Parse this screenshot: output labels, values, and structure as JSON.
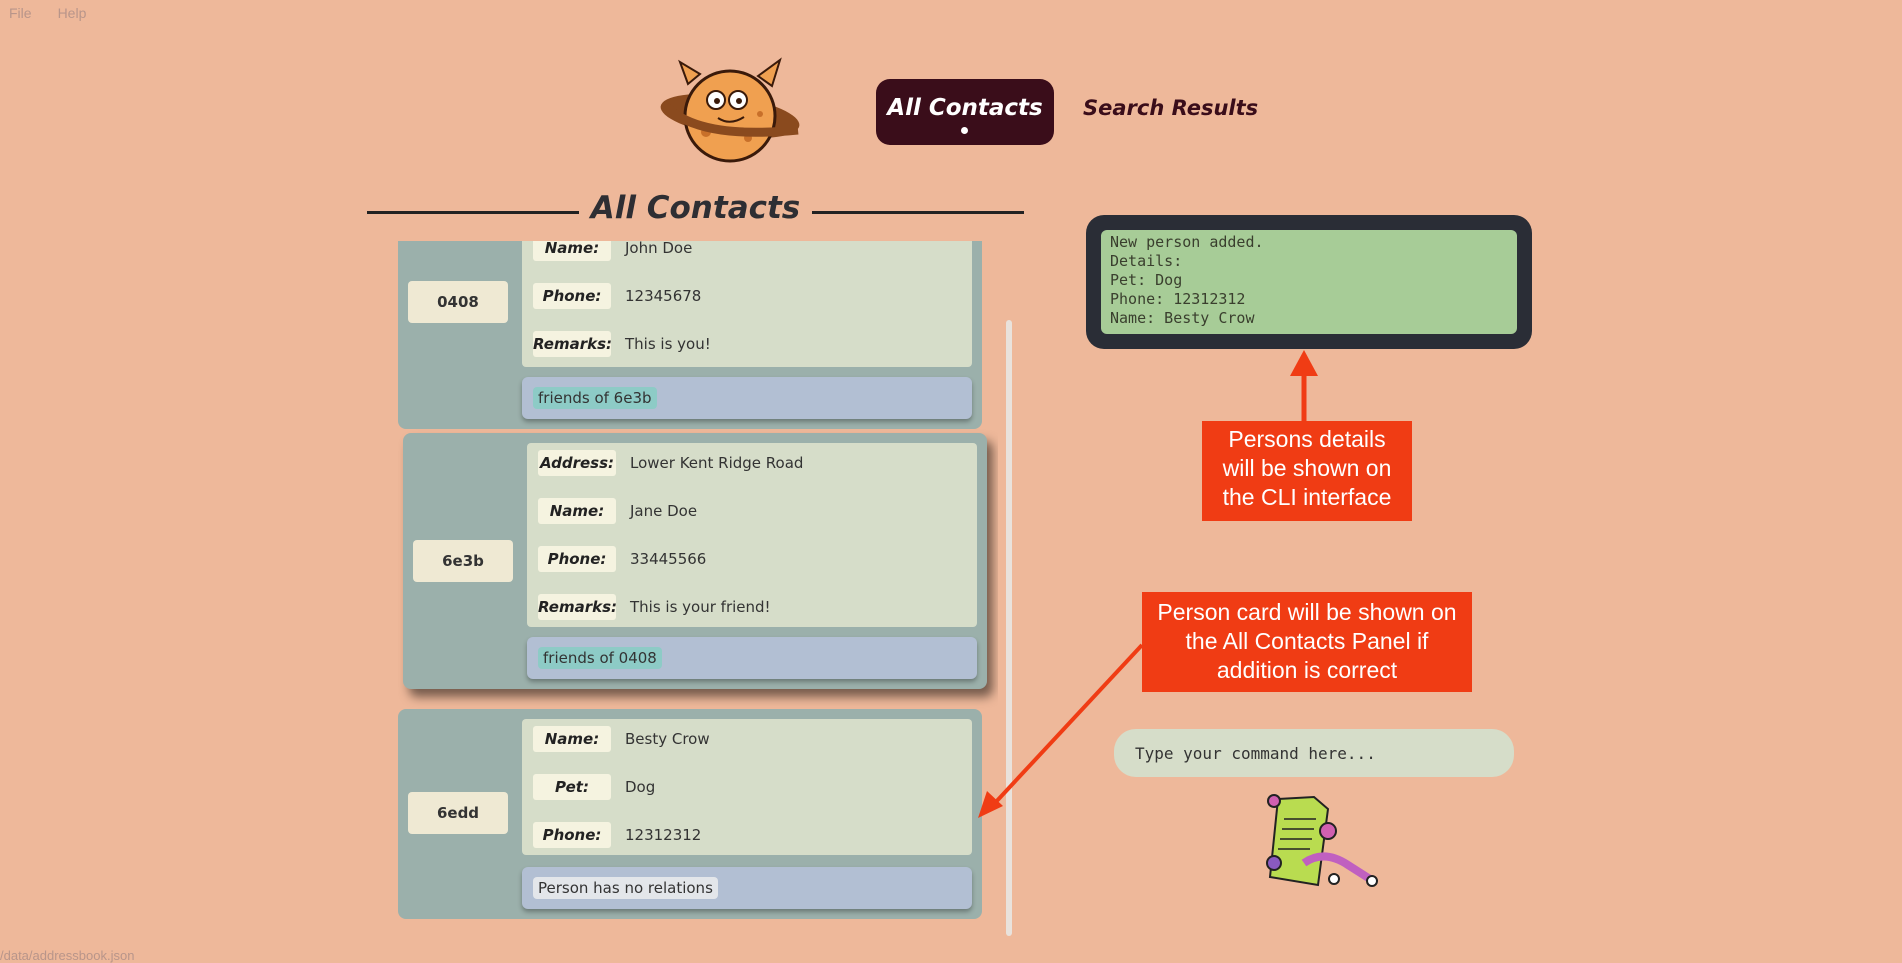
{
  "menu": {
    "file": "File",
    "help": "Help"
  },
  "tabs": {
    "active": "All Contacts",
    "inactive": "Search Results"
  },
  "panel": {
    "title": "All Contacts"
  },
  "contacts": [
    {
      "id": "0408",
      "fields": [
        {
          "label": "Name:",
          "value": "John Doe"
        },
        {
          "label": "Phone:",
          "value": "12345678"
        },
        {
          "label": "Remarks:",
          "value": "This is you!"
        }
      ],
      "tag": "friends of 6e3b"
    },
    {
      "id": "6e3b",
      "fields": [
        {
          "label": "Address:",
          "value": "Lower Kent Ridge Road"
        },
        {
          "label": "Name:",
          "value": "Jane Doe"
        },
        {
          "label": "Phone:",
          "value": "33445566"
        },
        {
          "label": "Remarks:",
          "value": "This is your friend!"
        }
      ],
      "tag": "friends of 0408"
    },
    {
      "id": "6edd",
      "fields": [
        {
          "label": "Name:",
          "value": "Besty Crow"
        },
        {
          "label": "Pet:",
          "value": "Dog"
        },
        {
          "label": "Phone:",
          "value": "12312312"
        }
      ],
      "tag": "Person has no relations"
    }
  ],
  "cli": {
    "lines": [
      "New person added.",
      "Details:",
      "Pet: Dog",
      "Phone: 12312312",
      "Name: Besty Crow"
    ]
  },
  "annotations": {
    "cli_note": [
      "Persons details",
      "will be shown on",
      "the CLI interface"
    ],
    "card_note": [
      "Person card will be shown on",
      "the All Contacts Panel if",
      "addition is correct"
    ]
  },
  "command": {
    "placeholder": "Type your command here..."
  },
  "footer": {
    "path": "/data/addressbook.json"
  },
  "colors": {
    "background": "#eeb89a",
    "accent": "#3a0d1a",
    "annotation": "#f03c14",
    "cli_screen": "#a7cc97"
  },
  "icons": {
    "logo": "planet-monster-logo-icon",
    "mascot": "monster-with-document-icon"
  }
}
